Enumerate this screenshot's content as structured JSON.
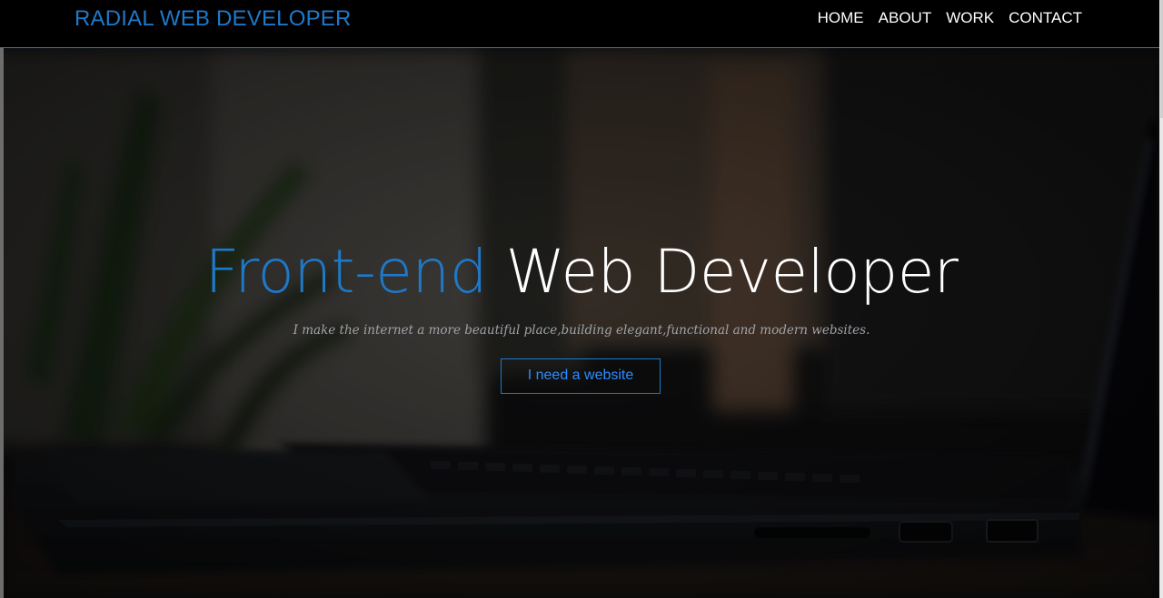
{
  "header": {
    "brand": "RADIAL WEB DEVELOPER",
    "nav": [
      {
        "label": "HOME"
      },
      {
        "label": "ABOUT"
      },
      {
        "label": "WORK"
      },
      {
        "label": "CONTACT"
      }
    ]
  },
  "hero": {
    "headline_blue": "Front-end",
    "headline_white": "Web Developer",
    "tagline": "I make the internet a more beautiful place,building elegant,functional and modern websites.",
    "cta_label": "I need a website",
    "background": "laptop-on-desk-with-plant-photo"
  },
  "colors": {
    "accent": "#1e79c9",
    "button_text": "#2d8cff",
    "header_bg": "#000000"
  }
}
